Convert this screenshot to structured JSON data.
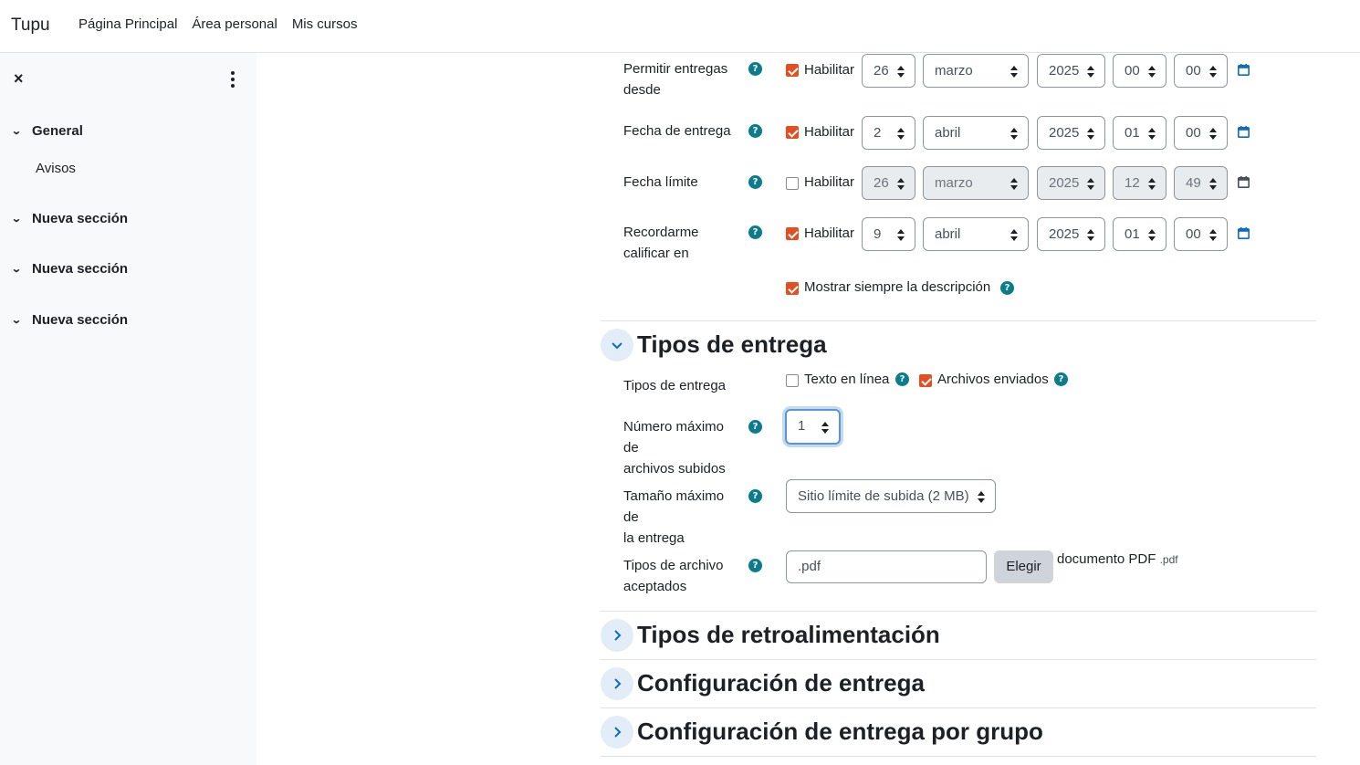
{
  "navbar": {
    "brand": "Tupu",
    "links": [
      "Página Principal",
      "Área personal",
      "Mis cursos"
    ]
  },
  "sidebar": {
    "close_icon": "×",
    "sections": [
      {
        "label": "General",
        "items": [
          "Avisos"
        ]
      },
      {
        "label": "Nueva sección",
        "items": []
      },
      {
        "label": "Nueva sección",
        "items": []
      },
      {
        "label": "Nueva sección",
        "items": []
      }
    ]
  },
  "dates": {
    "rows": [
      {
        "label_line1": "Permitir entregas",
        "label_line2": "desde",
        "enabled": true,
        "enable_label": "Habilitar",
        "day": "26",
        "month": "marzo",
        "year": "2025",
        "hour": "00",
        "minute": "00"
      },
      {
        "label_line1": "Fecha de entrega",
        "label_line2": "",
        "enabled": true,
        "enable_label": "Habilitar",
        "day": "2",
        "month": "abril",
        "year": "2025",
        "hour": "01",
        "minute": "00"
      },
      {
        "label_line1": "Fecha límite",
        "label_line2": "",
        "enabled": false,
        "enable_label": "Habilitar",
        "day": "26",
        "month": "marzo",
        "year": "2025",
        "hour": "12",
        "minute": "49"
      },
      {
        "label_line1": "Recordarme",
        "label_line2": "calificar en",
        "enabled": true,
        "enable_label": "Habilitar",
        "day": "9",
        "month": "abril",
        "year": "2025",
        "hour": "01",
        "minute": "00"
      }
    ],
    "always_show_description": {
      "checked": true,
      "label": "Mostrar siempre la descripción"
    }
  },
  "submission_types": {
    "title": "Tipos de entrega",
    "types_label": "Tipos de entrega",
    "online_text": {
      "checked": false,
      "label": "Texto en línea"
    },
    "file_submissions": {
      "checked": true,
      "label": "Archivos enviados"
    },
    "max_files_label_line1": "Número máximo de",
    "max_files_label_line2": "archivos subidos",
    "max_files_value": "1",
    "max_size_label_line1": "Tamaño máximo de",
    "max_size_label_line2": "la entrega",
    "max_size_value": "Sitio límite de subida (2 MB)",
    "accepted_label_line1": "Tipos de archivo",
    "accepted_label_line2": "aceptados",
    "accepted_value": ".pdf",
    "choose_button": "Elegir",
    "accepted_desc": "documento PDF",
    "accepted_ext": ".pdf"
  },
  "collapsed_sections": [
    "Tipos de retroalimentación",
    "Configuración de entrega",
    "Configuración de entrega por grupo"
  ],
  "colors": {
    "accent_checkbox": "#e34f21",
    "help_icon": "#0f7c91",
    "calendar_icon": "#0f6cbf",
    "sidebar_bg": "#f8f9fa"
  }
}
